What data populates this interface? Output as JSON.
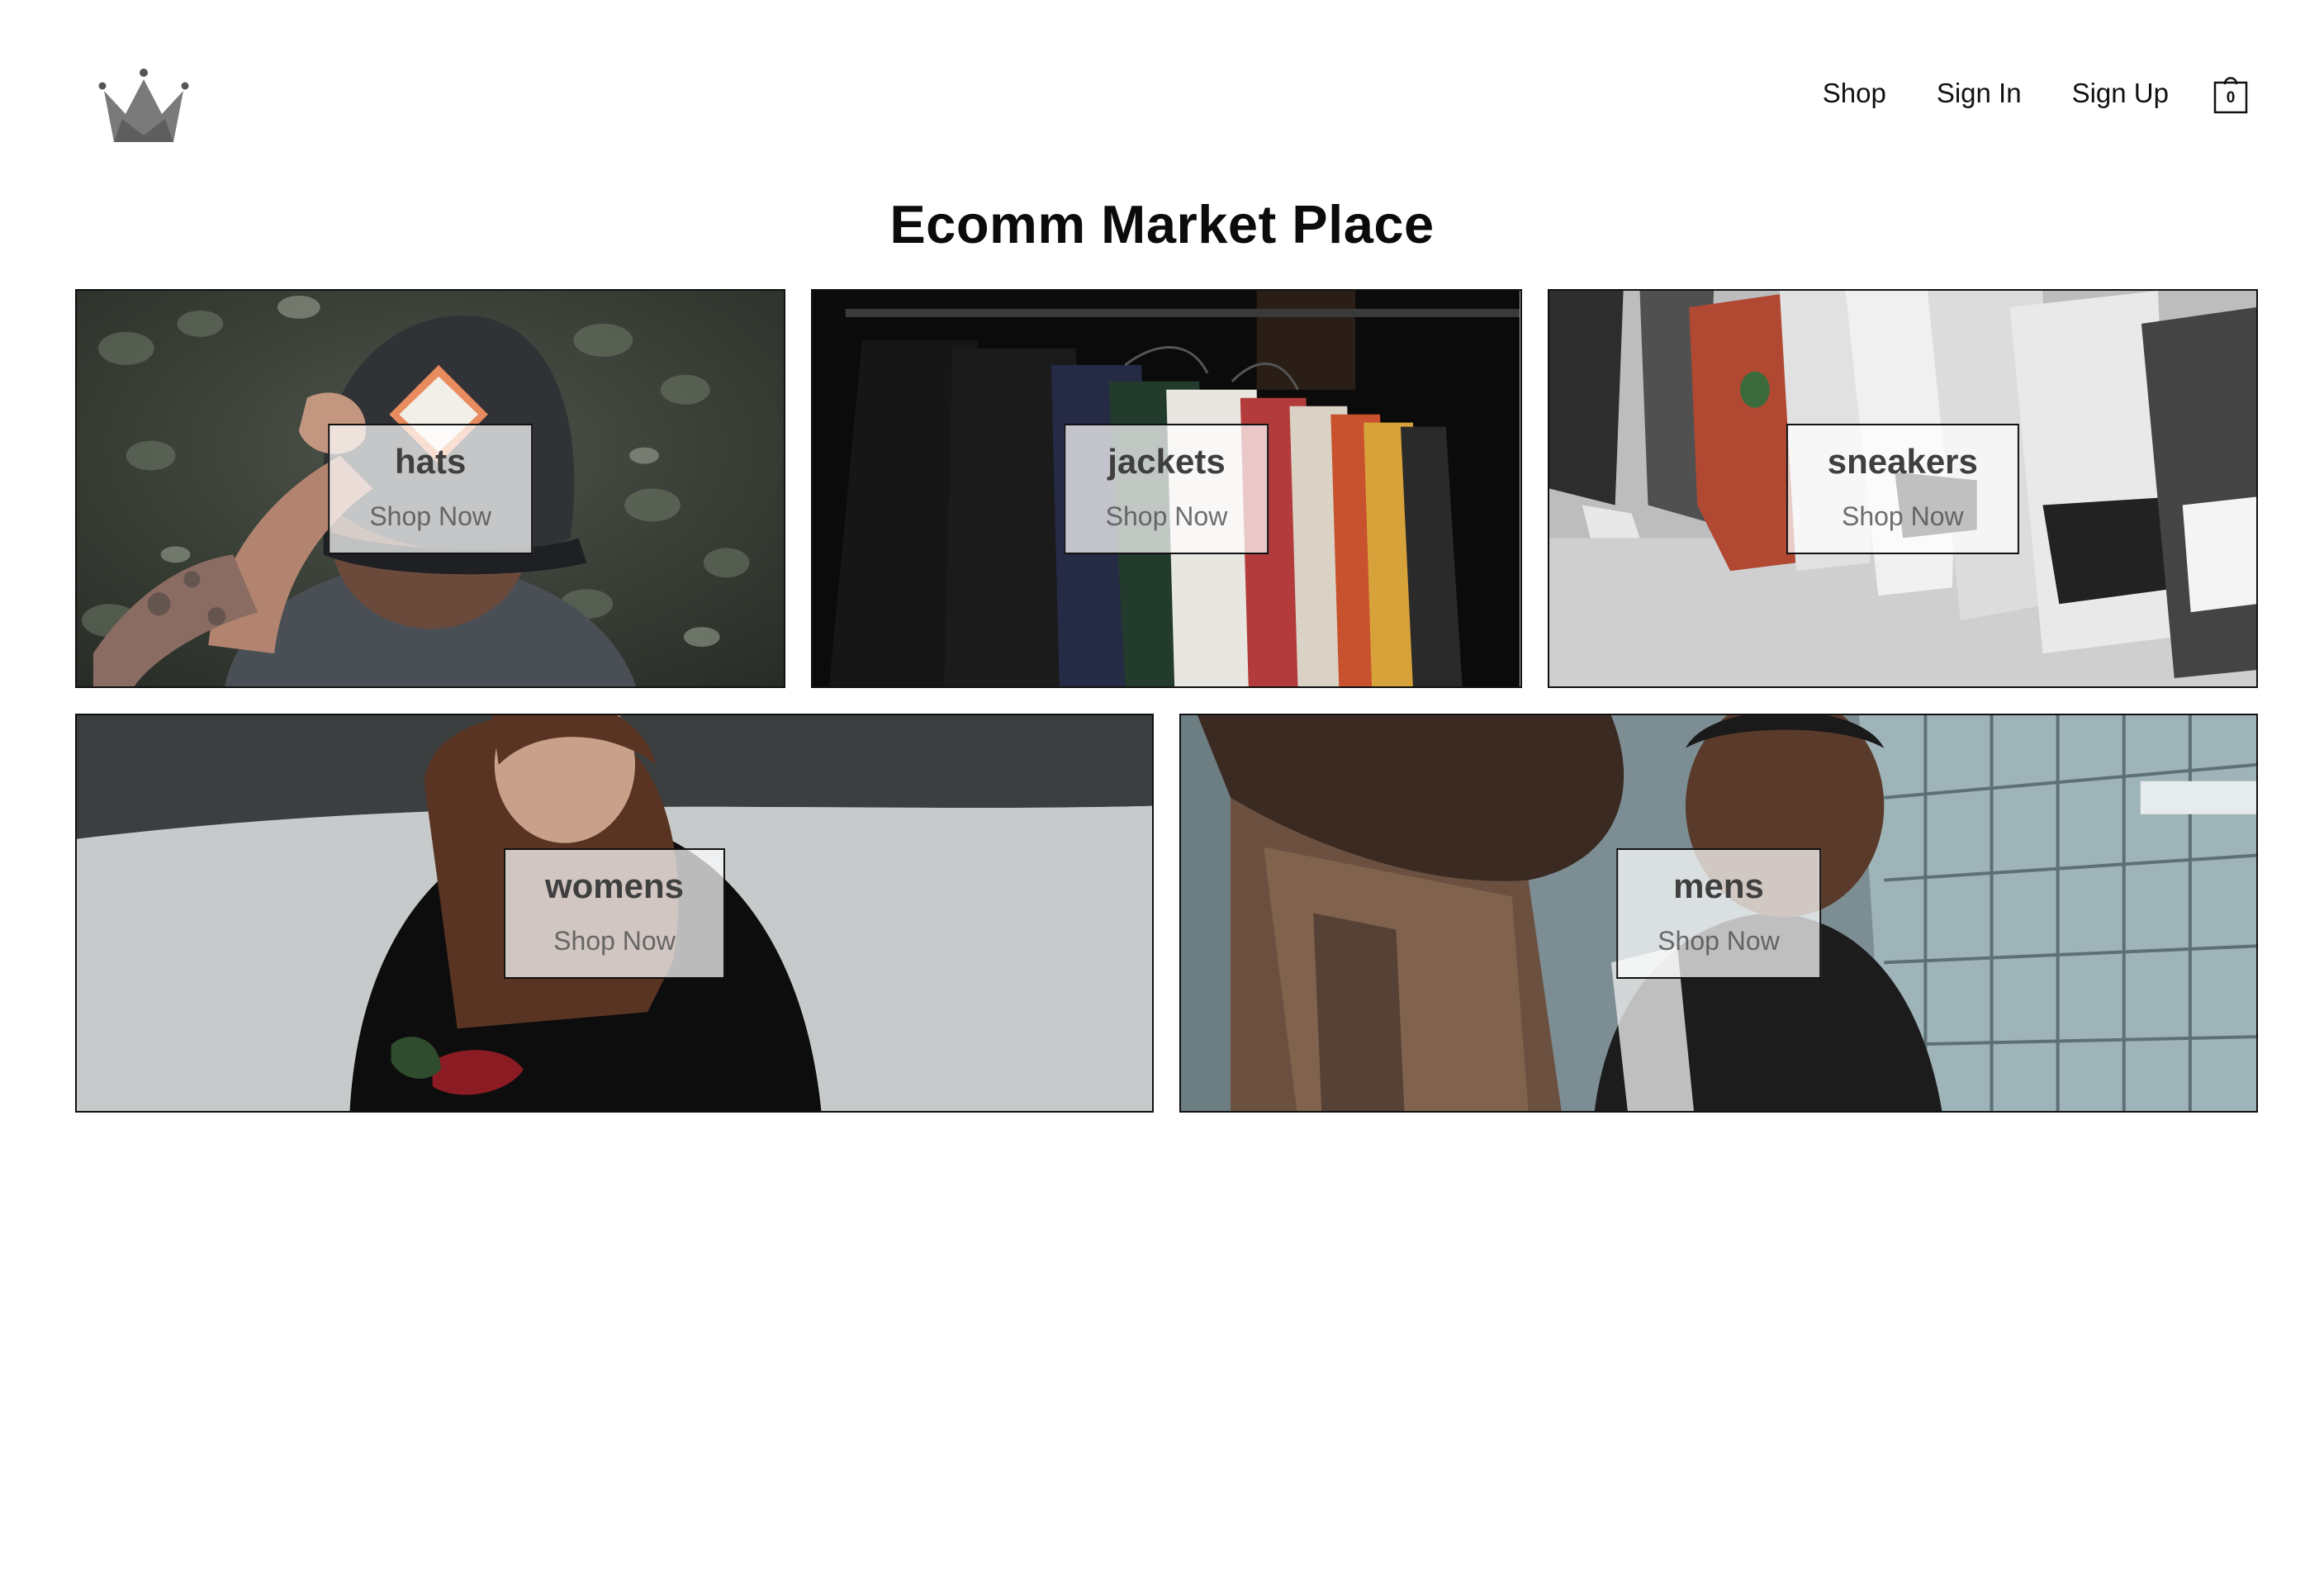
{
  "header": {
    "logo_icon": "crown-icon",
    "nav": [
      {
        "label": "Shop"
      },
      {
        "label": "Sign In"
      },
      {
        "label": "Sign Up"
      }
    ],
    "cart": {
      "icon": "shopping-bag-icon",
      "count": "0"
    }
  },
  "page_title": "Ecomm Market Place",
  "categories": [
    {
      "title": "hats",
      "cta": "Shop Now"
    },
    {
      "title": "jackets",
      "cta": "Shop Now"
    },
    {
      "title": "sneakers",
      "cta": "Shop Now"
    },
    {
      "title": "womens",
      "cta": "Shop Now"
    },
    {
      "title": "mens",
      "cta": "Shop Now"
    }
  ],
  "colors": {
    "text": "#111111",
    "label_bg": "#ffffffb8",
    "tile_border": "#111111"
  }
}
